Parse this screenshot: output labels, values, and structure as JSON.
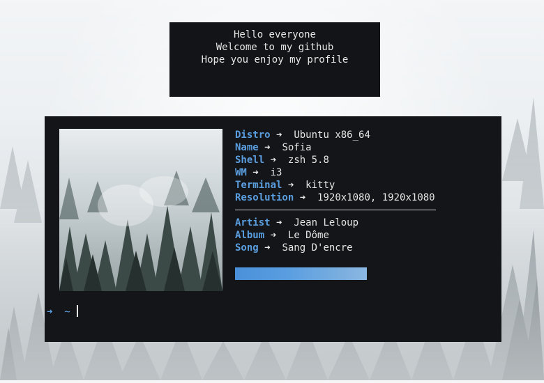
{
  "greeting": {
    "line1": "Hello everyone",
    "line2": "Welcome to my github",
    "line3": "Hope you enjoy my profile"
  },
  "system_info": [
    {
      "key": "Distro",
      "value": "Ubuntu x86_64"
    },
    {
      "key": "Name",
      "value": "Sofia"
    },
    {
      "key": "Shell",
      "value": "zsh 5.8"
    },
    {
      "key": "WM",
      "value": "i3"
    },
    {
      "key": "Terminal",
      "value": "kitty"
    },
    {
      "key": "Resolution",
      "value": "1920x1080, 1920x1080"
    }
  ],
  "music_info": [
    {
      "key": "Artist",
      "value": "Jean Leloup"
    },
    {
      "key": "Album",
      "value": "Le Dôme"
    },
    {
      "key": "Song",
      "value": "Sang D'encre"
    }
  ],
  "arrow_glyph": "➜",
  "prompt": {
    "arrow": "➜",
    "path": "~"
  },
  "colors": {
    "accent": "#5a9ee0",
    "panel": "#141518",
    "text": "#e6e6e6"
  },
  "icons": {
    "separator": "arrow-right-icon"
  }
}
